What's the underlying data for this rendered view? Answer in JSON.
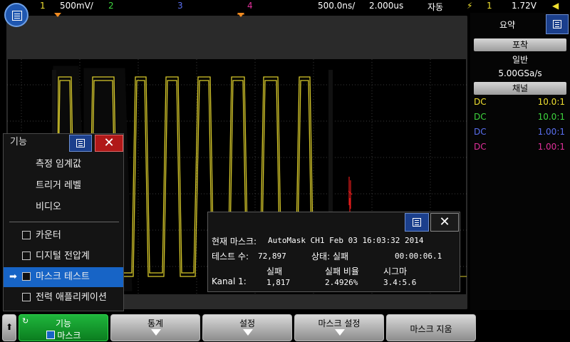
{
  "status_bar": {
    "ch1_num": "1",
    "ch1_scale": "500mV/",
    "ch2_num": "2",
    "ch3_num": "3",
    "ch4_num": "4",
    "timebase": "500.0ns/",
    "delay": "2.000us",
    "trigger_mode": "자동",
    "trigger_source": "1",
    "trigger_level": "1.72V"
  },
  "colors": {
    "ch1": "#f0e030",
    "ch2": "#3ed63e",
    "ch3": "#5a6ff0",
    "ch4": "#e0309a",
    "accent": "#1764c6"
  },
  "right_panel": {
    "tab_label": "요약",
    "acquisition_header": "포착",
    "acquisition_mode": "일반",
    "sample_rate": "5.00GSa/s",
    "channel_header": "채널",
    "channels": [
      {
        "coupling": "DC",
        "probe": "10.0:1"
      },
      {
        "coupling": "DC",
        "probe": "10.0:1"
      },
      {
        "coupling": "DC",
        "probe": "1.00:1"
      },
      {
        "coupling": "DC",
        "probe": "1.00:1"
      }
    ]
  },
  "function_menu": {
    "title": "기능",
    "items": [
      "측정 임계값",
      "트리거 레벨",
      "비디오"
    ],
    "check_items": [
      "카운터",
      "디지털 전압계",
      "마스크 테스트",
      "전력 애플리케이션"
    ],
    "selected_index": 2
  },
  "mask_popup": {
    "current_mask_label": "현재 마스크:",
    "current_mask_value": "AutoMask CH1 Feb 03 16:03:32 2014",
    "tests_label": "테스트 수:",
    "tests_value": "72,897",
    "status_label": "상태: 실패",
    "elapsed": "00:00:06.1",
    "col_fail": "실패",
    "col_fail_rate": "실패 비율",
    "col_sigma": "시그마",
    "row_label": "Kanal 1:",
    "fail_value": "1,817",
    "fail_rate_value": "2.4926%",
    "sigma_value": "3.4:5.6"
  },
  "softkeys": {
    "function_line1": "기능",
    "function_line2": "마스크",
    "statistics": "통계",
    "setup": "설정",
    "mask_setup": "마스크 설정",
    "clear_mask": "마스크 지움"
  }
}
